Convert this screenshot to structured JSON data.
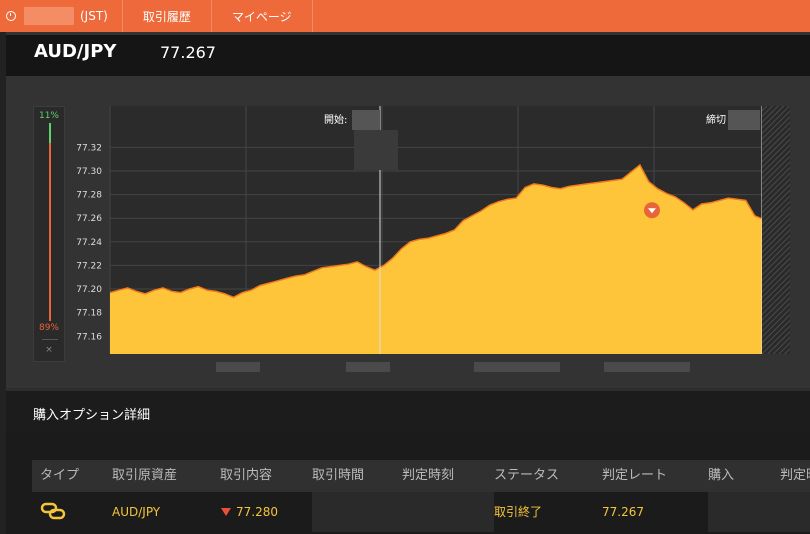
{
  "topbar": {
    "time_suffix": "(JST)",
    "nav": [
      "取引履歴",
      "マイページ"
    ]
  },
  "header": {
    "pair": "AUD/JPY",
    "price": "77.267"
  },
  "payout": {
    "high_pct": "11%",
    "low_pct": "89%",
    "close_glyph": "×"
  },
  "chart_labels": {
    "start": "開始:",
    "end": "締切"
  },
  "detail": {
    "title": "購入オプション詳細"
  },
  "table": {
    "headers": [
      "タイプ",
      "取引原資産",
      "取引内容",
      "取引時間",
      "判定時刻",
      "ステータス",
      "判定レート",
      "購入",
      "判定時"
    ],
    "row": {
      "asset": "AUD/JPY",
      "content": "77.280",
      "status": "取引終了",
      "rate": "77.267"
    }
  },
  "chart_data": {
    "type": "area",
    "yticks": [
      77.32,
      77.3,
      77.28,
      77.26,
      77.24,
      77.22,
      77.2,
      77.18,
      77.16
    ],
    "ylim": [
      77.145,
      77.355
    ],
    "fill": "#fec53a",
    "stroke": "#f07a1a",
    "entry_marker_value": 77.26,
    "values": [
      77.197,
      77.199,
      77.201,
      77.198,
      77.196,
      77.199,
      77.201,
      77.198,
      77.197,
      77.2,
      77.202,
      77.199,
      77.198,
      77.196,
      77.193,
      77.197,
      77.199,
      77.203,
      77.205,
      77.207,
      77.209,
      77.211,
      77.212,
      77.215,
      77.218,
      77.219,
      77.22,
      77.221,
      77.223,
      77.219,
      77.216,
      77.22,
      77.226,
      77.234,
      77.24,
      77.242,
      77.243,
      77.245,
      77.247,
      77.25,
      77.258,
      77.262,
      77.266,
      77.271,
      77.274,
      77.276,
      77.277,
      77.286,
      77.289,
      77.288,
      77.286,
      77.285,
      77.287,
      77.288,
      77.289,
      77.29,
      77.291,
      77.292,
      77.293,
      77.299,
      77.305,
      77.291,
      77.285,
      77.281,
      77.278,
      77.273,
      77.267,
      77.272,
      77.273,
      77.275,
      77.277,
      77.276,
      77.275,
      77.262,
      77.259,
      77.261,
      77.263,
      77.264
    ]
  }
}
